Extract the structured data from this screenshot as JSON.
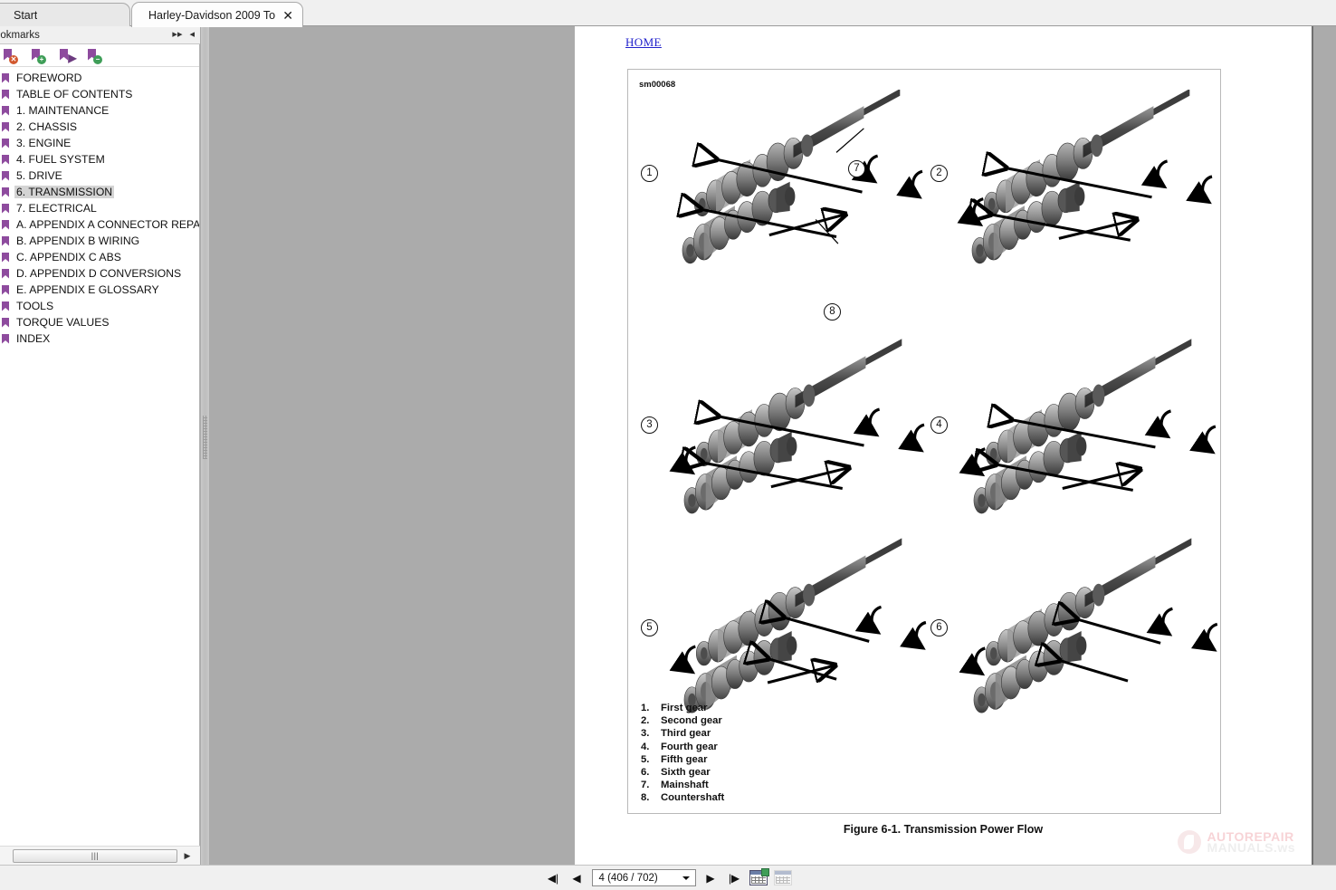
{
  "tabs": [
    {
      "label": "Start",
      "active": false,
      "closable": false
    },
    {
      "label": "Harley-Davidson 2009 To...",
      "active": true,
      "closable": true,
      "close_glyph": "✕"
    }
  ],
  "bookmarks_panel": {
    "title": "ookmarks",
    "header_buttons": [
      {
        "name": "expand-all",
        "glyph": "▸▸"
      },
      {
        "name": "collapse-panel",
        "glyph": "◂"
      }
    ],
    "toolbar": [
      {
        "name": "delete-bookmark-icon",
        "badge": "✕",
        "badge_color": "#d2582e"
      },
      {
        "name": "new-bookmark-icon",
        "badge": "+",
        "badge_color": "#3f9e58"
      },
      {
        "name": "goto-bookmark-icon",
        "badge": "▶",
        "badge_color": "transparent"
      },
      {
        "name": "remove-bookmark-icon",
        "badge": "−",
        "badge_color": "#3f9e58"
      }
    ],
    "items": [
      {
        "label": "FOREWORD",
        "selected": false
      },
      {
        "label": "TABLE OF CONTENTS",
        "selected": false
      },
      {
        "label": "1. MAINTENANCE",
        "selected": false
      },
      {
        "label": "2. CHASSIS",
        "selected": false
      },
      {
        "label": "3. ENGINE",
        "selected": false
      },
      {
        "label": "4. FUEL SYSTEM",
        "selected": false
      },
      {
        "label": "5. DRIVE",
        "selected": false
      },
      {
        "label": "6. TRANSMISSION",
        "selected": true
      },
      {
        "label": "7. ELECTRICAL",
        "selected": false
      },
      {
        "label": "A. APPENDIX A CONNECTOR REPAIR",
        "selected": false
      },
      {
        "label": "B. APPENDIX B WIRING",
        "selected": false
      },
      {
        "label": "C. APPENDIX C ABS",
        "selected": false
      },
      {
        "label": "D. APPENDIX D CONVERSIONS",
        "selected": false
      },
      {
        "label": "E. APPENDIX E GLOSSARY",
        "selected": false
      },
      {
        "label": "TOOLS",
        "selected": false
      },
      {
        "label": "TORQUE VALUES",
        "selected": false
      },
      {
        "label": "INDEX",
        "selected": false
      }
    ],
    "hscroll_grip": "|||",
    "hscroll_right_glyph": "▶"
  },
  "document": {
    "home_link": "HOME",
    "figure_id": "sm00068",
    "caption": "Figure 6-1. Transmission Power Flow",
    "panels": [
      {
        "number": "1",
        "extra_callouts": [
          {
            "number": "7"
          },
          {
            "number": "8"
          }
        ]
      },
      {
        "number": "2",
        "extra_callouts": []
      },
      {
        "number": "3",
        "extra_callouts": []
      },
      {
        "number": "4",
        "extra_callouts": []
      },
      {
        "number": "5",
        "extra_callouts": []
      },
      {
        "number": "6",
        "extra_callouts": []
      }
    ],
    "legend": [
      {
        "num": "1.",
        "label": "First gear"
      },
      {
        "num": "2.",
        "label": "Second gear"
      },
      {
        "num": "3.",
        "label": "Third gear"
      },
      {
        "num": "4.",
        "label": "Fourth gear"
      },
      {
        "num": "5.",
        "label": "Fifth gear"
      },
      {
        "num": "6.",
        "label": "Sixth gear"
      },
      {
        "num": "7.",
        "label": "Mainshaft"
      },
      {
        "num": "8.",
        "label": "Countershaft"
      }
    ],
    "watermark": {
      "line1": "AUTOREPAIR",
      "line2": "MANUALS.ws"
    }
  },
  "bottom_toolbar": {
    "first_page": "◀|",
    "prev_page": "◀",
    "page_value": "4 (406 / 702)",
    "next_page": "▶",
    "last_page": "|▶",
    "view_single": "single-page-view",
    "view_double": "double-page-view"
  }
}
